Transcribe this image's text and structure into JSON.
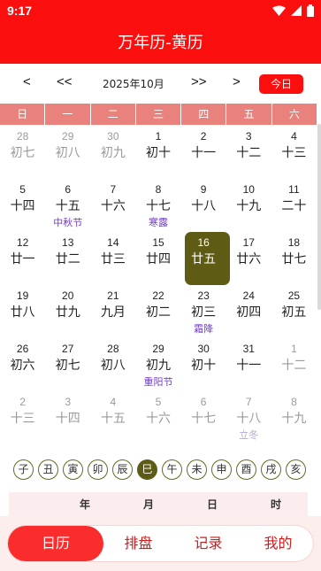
{
  "status_bar": {
    "time": "9:17"
  },
  "header": {
    "title": "万年历-黄历"
  },
  "month_nav": {
    "prev_month": "<",
    "prev_year": "<<",
    "month_label": "2025年10月",
    "next_year": ">>",
    "next_month": ">",
    "today": "今日"
  },
  "weekdays": [
    "日",
    "一",
    "二",
    "三",
    "四",
    "五",
    "六"
  ],
  "days": [
    {
      "solar": "28",
      "lunar": "初七",
      "festival": "",
      "other": true
    },
    {
      "solar": "29",
      "lunar": "初八",
      "festival": "",
      "other": true
    },
    {
      "solar": "30",
      "lunar": "初九",
      "festival": "",
      "other": true
    },
    {
      "solar": "1",
      "lunar": "初十",
      "festival": "",
      "other": false
    },
    {
      "solar": "2",
      "lunar": "十一",
      "festival": "",
      "other": false
    },
    {
      "solar": "3",
      "lunar": "十二",
      "festival": "",
      "other": false
    },
    {
      "solar": "4",
      "lunar": "十三",
      "festival": "",
      "other": false
    },
    {
      "solar": "5",
      "lunar": "十四",
      "festival": "",
      "other": false
    },
    {
      "solar": "6",
      "lunar": "十五",
      "festival": "中秋节",
      "other": false
    },
    {
      "solar": "7",
      "lunar": "十六",
      "festival": "",
      "other": false
    },
    {
      "solar": "8",
      "lunar": "十七",
      "festival": "寒露",
      "other": false
    },
    {
      "solar": "9",
      "lunar": "十八",
      "festival": "",
      "other": false
    },
    {
      "solar": "10",
      "lunar": "十九",
      "festival": "",
      "other": false
    },
    {
      "solar": "11",
      "lunar": "二十",
      "festival": "",
      "other": false
    },
    {
      "solar": "12",
      "lunar": "廿一",
      "festival": "",
      "other": false
    },
    {
      "solar": "13",
      "lunar": "廿二",
      "festival": "",
      "other": false
    },
    {
      "solar": "14",
      "lunar": "廿三",
      "festival": "",
      "other": false
    },
    {
      "solar": "15",
      "lunar": "廿四",
      "festival": "",
      "other": false
    },
    {
      "solar": "16",
      "lunar": "廿五",
      "festival": "",
      "other": false,
      "selected": true
    },
    {
      "solar": "17",
      "lunar": "廿六",
      "festival": "",
      "other": false
    },
    {
      "solar": "18",
      "lunar": "廿七",
      "festival": "",
      "other": false
    },
    {
      "solar": "19",
      "lunar": "廿八",
      "festival": "",
      "other": false
    },
    {
      "solar": "20",
      "lunar": "廿九",
      "festival": "",
      "other": false
    },
    {
      "solar": "21",
      "lunar": "九月",
      "festival": "",
      "other": false
    },
    {
      "solar": "22",
      "lunar": "初二",
      "festival": "",
      "other": false
    },
    {
      "solar": "23",
      "lunar": "初三",
      "festival": "霜降",
      "other": false
    },
    {
      "solar": "24",
      "lunar": "初四",
      "festival": "",
      "other": false
    },
    {
      "solar": "25",
      "lunar": "初五",
      "festival": "",
      "other": false
    },
    {
      "solar": "26",
      "lunar": "初六",
      "festival": "",
      "other": false
    },
    {
      "solar": "27",
      "lunar": "初七",
      "festival": "",
      "other": false
    },
    {
      "solar": "28",
      "lunar": "初八",
      "festival": "",
      "other": false
    },
    {
      "solar": "29",
      "lunar": "初九",
      "festival": "重阳节",
      "other": false
    },
    {
      "solar": "30",
      "lunar": "初十",
      "festival": "",
      "other": false
    },
    {
      "solar": "31",
      "lunar": "十一",
      "festival": "",
      "other": false
    },
    {
      "solar": "1",
      "lunar": "十二",
      "festival": "",
      "other": true
    },
    {
      "solar": "2",
      "lunar": "十三",
      "festival": "",
      "other": true
    },
    {
      "solar": "3",
      "lunar": "十四",
      "festival": "",
      "other": true
    },
    {
      "solar": "4",
      "lunar": "十五",
      "festival": "",
      "other": true
    },
    {
      "solar": "5",
      "lunar": "十六",
      "festival": "",
      "other": true
    },
    {
      "solar": "6",
      "lunar": "十七",
      "festival": "",
      "other": true
    },
    {
      "solar": "7",
      "lunar": "十八",
      "festival": "立冬",
      "other": true
    },
    {
      "solar": "8",
      "lunar": "十九",
      "festival": "",
      "other": true
    }
  ],
  "branches": [
    "子",
    "丑",
    "寅",
    "卯",
    "辰",
    "巳",
    "午",
    "未",
    "申",
    "酉",
    "戌",
    "亥"
  ],
  "active_branch": "巳",
  "pillars": {
    "year": "年",
    "month": "月",
    "day": "日",
    "hour": "时"
  },
  "tabs": [
    {
      "label": "日历",
      "active": true
    },
    {
      "label": "排盘",
      "active": false
    },
    {
      "label": "记录",
      "active": false
    },
    {
      "label": "我的",
      "active": false
    }
  ],
  "colors": {
    "primary": "#fa0e0e",
    "weekday_bg": "#e9827c",
    "selected": "#5d5b14",
    "festival": "#6f3cc5"
  }
}
